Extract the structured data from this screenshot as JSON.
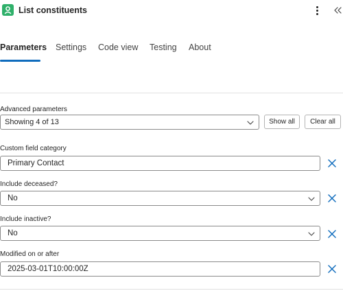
{
  "header": {
    "title": "List constituents",
    "app_icon": "app-logo-icon",
    "more_icon": "more-vertical-icon",
    "collapse_icon": "double-chevron-left-icon"
  },
  "tabs": [
    {
      "label": "Parameters",
      "active": true
    },
    {
      "label": "Settings",
      "active": false
    },
    {
      "label": "Code view",
      "active": false
    },
    {
      "label": "Testing",
      "active": false
    },
    {
      "label": "About",
      "active": false
    }
  ],
  "advanced": {
    "label": "Advanced parameters",
    "value": "Showing 4 of 13",
    "show_all": "Show all",
    "clear_all": "Clear all"
  },
  "fields": [
    {
      "label": "Custom field category",
      "value": "Primary Contact",
      "type": "text"
    },
    {
      "label": "Include deceased?",
      "value": "No",
      "type": "select"
    },
    {
      "label": "Include inactive?",
      "value": "No",
      "type": "select"
    },
    {
      "label": "Modified on or after",
      "value": "2025-03-01T10:00:00Z",
      "type": "text"
    }
  ],
  "colors": {
    "accent": "#0f6cbd",
    "app_icon": "#2fb06a",
    "remove_icon": "#0f6cbd"
  }
}
